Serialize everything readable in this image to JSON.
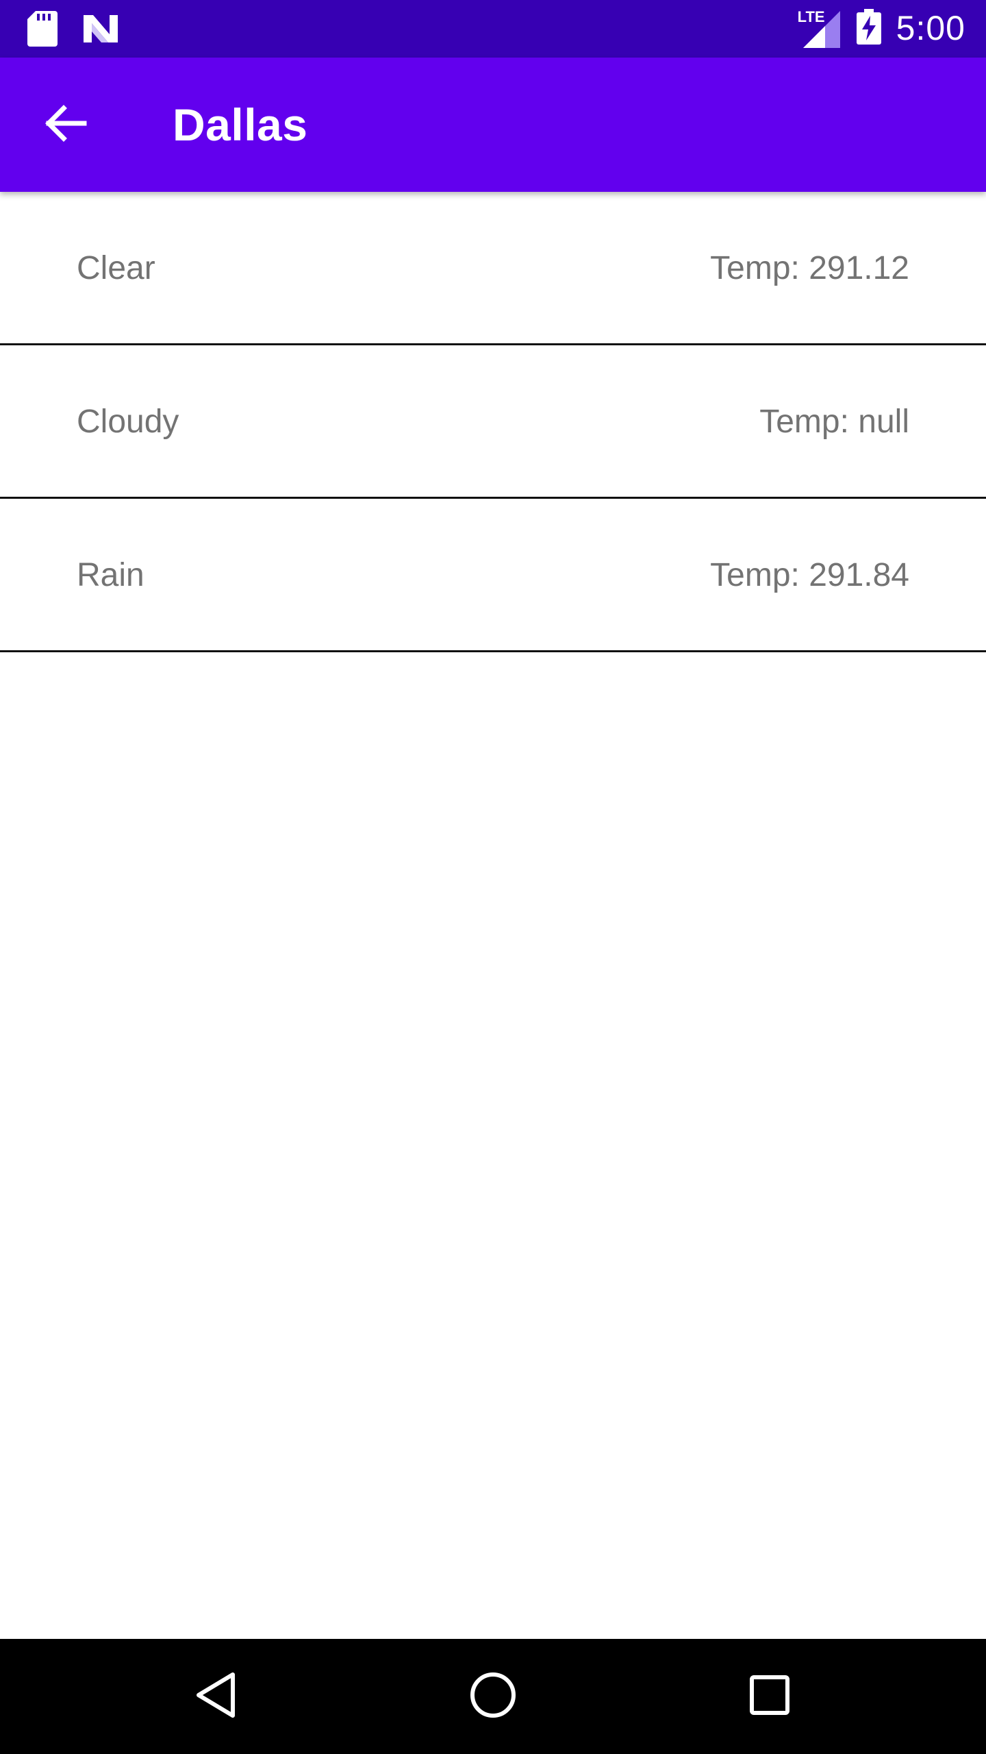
{
  "status_bar": {
    "time": "5:00",
    "network_label": "LTE",
    "icons": [
      "sd-card-icon",
      "n-logo-icon",
      "signal-icon",
      "battery-charging-icon"
    ]
  },
  "app_bar": {
    "title": "Dallas",
    "back_icon": "arrow-back-icon",
    "color": "#6200ee"
  },
  "forecast_list": [
    {
      "condition": "Clear",
      "temp": "Temp: 291.12"
    },
    {
      "condition": "Cloudy",
      "temp": "Temp: null"
    },
    {
      "condition": "Rain",
      "temp": "Temp: 291.84"
    }
  ],
  "nav_bar": {
    "icons": [
      "back-triangle-icon",
      "home-circle-icon",
      "recents-square-icon"
    ]
  },
  "colors": {
    "status_bar": "#3700b3",
    "app_bar": "#6200ee",
    "row_text": "#737373",
    "divider": "#111111"
  }
}
